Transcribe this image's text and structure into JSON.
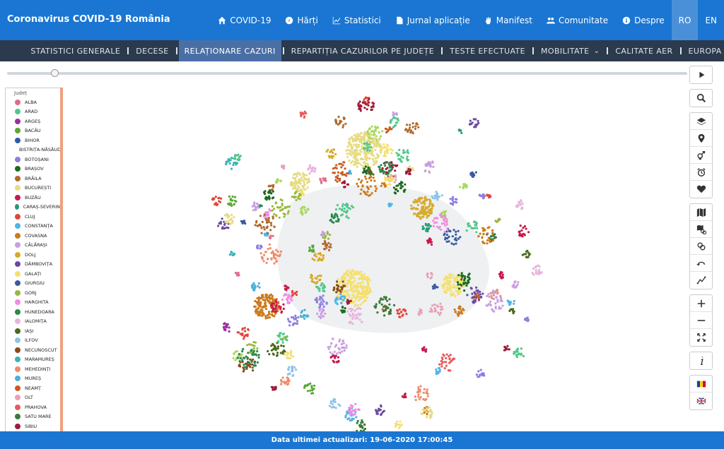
{
  "header": {
    "brand": "Coronavirus COVID-19 România"
  },
  "topnav": [
    {
      "label": "COVID-19",
      "icon": "home-icon"
    },
    {
      "label": "Hărți",
      "icon": "compass-icon"
    },
    {
      "label": "Statistici",
      "icon": "chart-icon"
    },
    {
      "label": "Jurnal aplicație",
      "icon": "document-icon"
    },
    {
      "label": "Manifest",
      "icon": "hand-icon"
    },
    {
      "label": "Comunitate",
      "icon": "users-icon"
    },
    {
      "label": "Despre",
      "icon": "info-icon"
    },
    {
      "label": "RO",
      "icon": ""
    },
    {
      "label": "EN",
      "icon": ""
    }
  ],
  "subnav": [
    "STATISTICI GENERALE",
    "DECESE",
    "RELAȚIONARE CAZURI",
    "REPARTIȚIA CAZURILOR PE JUDEȚE",
    "TESTE EFECTUATE",
    "MOBILITATE",
    "CALITATE AER",
    "EUROPA"
  ],
  "legend": {
    "title": "Județ",
    "items": [
      {
        "name": "ALBA",
        "color": "#e06c8c"
      },
      {
        "name": "ARAD",
        "color": "#52c88a"
      },
      {
        "name": "ARGEȘ",
        "color": "#9b2fa0"
      },
      {
        "name": "BACĂU",
        "color": "#5aa832"
      },
      {
        "name": "BIHOR",
        "color": "#2f5aa8"
      },
      {
        "name": "BISTRIȚA-NĂSĂUD",
        "color": "#a8d860"
      },
      {
        "name": "BOTOȘANI",
        "color": "#8e7ee0"
      },
      {
        "name": "BRAȘOV",
        "color": "#1c6a1c"
      },
      {
        "name": "BRĂILA",
        "color": "#b06a2a"
      },
      {
        "name": "BUCUREȘTI",
        "color": "#e6dc82"
      },
      {
        "name": "BUZĂU",
        "color": "#c8184a"
      },
      {
        "name": "CARAȘ-SEVERIN",
        "color": "#2a9a7a"
      },
      {
        "name": "CLUJ",
        "color": "#e0463c"
      },
      {
        "name": "CONSTANȚA",
        "color": "#50b4e8"
      },
      {
        "name": "COVASNA",
        "color": "#cc7a1c"
      },
      {
        "name": "CĂLĂRAȘI",
        "color": "#c8a0e0"
      },
      {
        "name": "DOLJ",
        "color": "#d8aa2a"
      },
      {
        "name": "DÂMBOVIȚA",
        "color": "#6a4aa0"
      },
      {
        "name": "GALAȚI",
        "color": "#f4e070"
      },
      {
        "name": "GIURGIU",
        "color": "#3a5aa0"
      },
      {
        "name": "GORJ",
        "color": "#9ab83c"
      },
      {
        "name": "HARGHITA",
        "color": "#f08ce0"
      },
      {
        "name": "HUNEDOARA",
        "color": "#2a8a4a"
      },
      {
        "name": "IALOMIȚA",
        "color": "#e8b4dc"
      },
      {
        "name": "IAȘI",
        "color": "#4a6a1c"
      },
      {
        "name": "ILFOV",
        "color": "#8cc4e8"
      },
      {
        "name": "NECUNOSCUT",
        "color": "#8a4a1c"
      },
      {
        "name": "MARAMUREȘ",
        "color": "#3ab4b4"
      },
      {
        "name": "MEHEDINȚI",
        "color": "#f08a6a"
      },
      {
        "name": "MUREȘ",
        "color": "#4ab0d8"
      },
      {
        "name": "NEAMȚ",
        "color": "#cc5a1c"
      },
      {
        "name": "OLT",
        "color": "#e8a0b4"
      },
      {
        "name": "PRAHOVA",
        "color": "#e85a5a"
      },
      {
        "name": "SATU MARE",
        "color": "#3a7a3a"
      },
      {
        "name": "SIBIU",
        "color": "#a01c3a"
      }
    ]
  },
  "footer": {
    "label": "Data ultimei actualizari: 19-06-2020 17:00:45"
  },
  "toolbar": [
    "play-icon",
    "search-icon",
    "layers-icon",
    "pin-icon",
    "gender-icon",
    "alarm-icon",
    "heart-icon",
    "map-icon",
    "map-link-icon",
    "link-icon",
    "undo-icon",
    "trend-icon",
    "zoom-in-icon",
    "zoom-out-icon",
    "fullscreen-icon",
    "info-icon",
    "flag-ro-icon",
    "flag-en-icon"
  ]
}
